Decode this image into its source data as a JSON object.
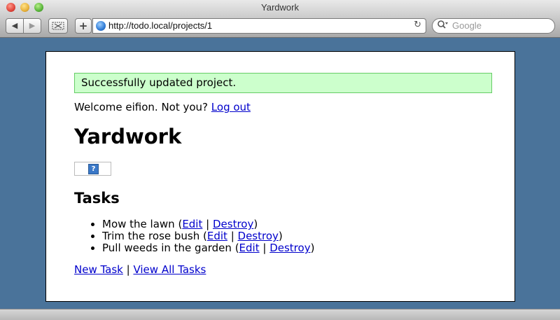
{
  "window": {
    "title": "Yardwork"
  },
  "toolbar": {
    "url": "http://todo.local/projects/1",
    "search_placeholder": "Google",
    "back_icon": "◀",
    "forward_icon": "▶",
    "plus_icon": "+",
    "reload_icon": "↻"
  },
  "page": {
    "flash": "Successfully updated project.",
    "welcome_text": "Welcome eifion. Not you?",
    "logout_label": "Log out",
    "title": "Yardwork",
    "tasks_heading": "Tasks",
    "tasks": [
      {
        "name": "Mow the lawn",
        "edit": "Edit",
        "destroy": "Destroy"
      },
      {
        "name": "Trim the rose bush",
        "edit": "Edit",
        "destroy": "Destroy"
      },
      {
        "name": "Pull weeds in the garden",
        "edit": "Edit",
        "destroy": "Destroy"
      }
    ],
    "new_task_label": "New Task",
    "view_all_label": "View All Tasks"
  }
}
